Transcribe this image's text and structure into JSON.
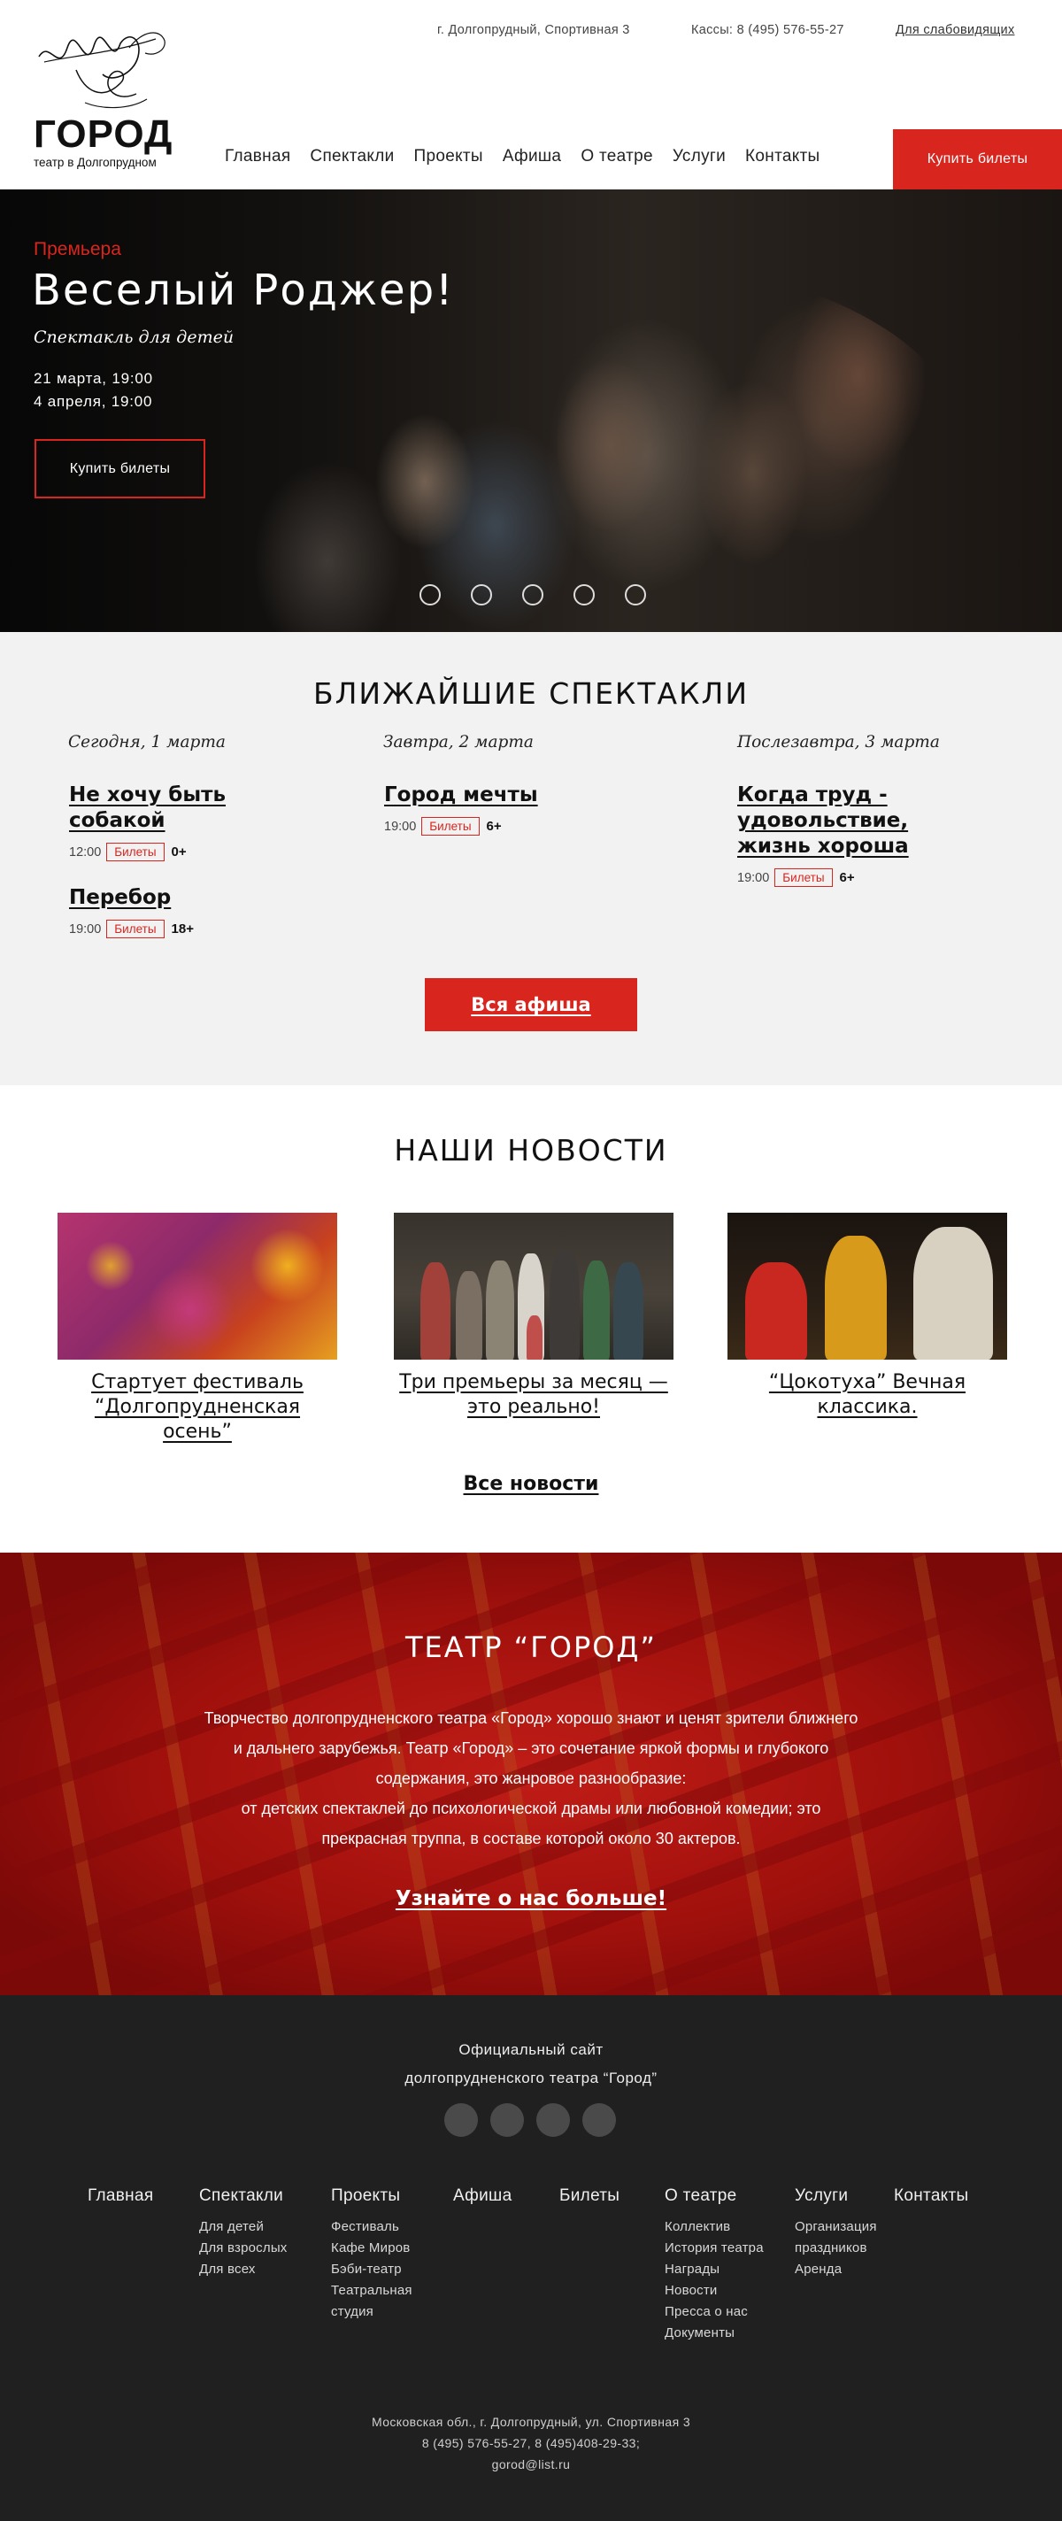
{
  "header": {
    "logo_name": "ГОРОД",
    "logo_sub": "театр в Долгопрудном",
    "address": "г. Долгопрудный, Спортивная 3",
    "phone": "Кассы: 8 (495) 576-55-27",
    "accessibility": "Для слабовидящих",
    "nav": [
      "Главная",
      "Спектакли",
      "Проекты",
      "Афиша",
      "О театре",
      "Услуги",
      "Контакты"
    ],
    "buy_button": "Купить билеты"
  },
  "hero": {
    "kicker": "Премьера",
    "title": "Веселый Роджер!",
    "subtitle": "Спектакль для детей",
    "dates": [
      "21 марта, 19:00",
      "4 апреля, 19:00"
    ],
    "button": "Купить билеты",
    "slide_count": 5
  },
  "upcoming": {
    "title": "БЛИЖАЙШИЕ СПЕКТАКЛИ",
    "days": [
      {
        "label": "Сегодня, 1 марта",
        "shows": [
          {
            "name": "Не хочу быть собакой",
            "time": "12:00",
            "ticket": "Билеты",
            "age": "0+"
          },
          {
            "name": "Перебор",
            "time": "19:00",
            "ticket": "Билеты",
            "age": "18+"
          }
        ]
      },
      {
        "label": "Завтра, 2 марта",
        "shows": [
          {
            "name": "Город мечты",
            "time": "19:00",
            "ticket": "Билеты",
            "age": "6+"
          }
        ]
      },
      {
        "label": "Послезавтра, 3 марта",
        "shows": [
          {
            "name": "Когда труд - удовольствие, жизнь хороша",
            "time": "19:00",
            "ticket": "Билеты",
            "age": "6+"
          }
        ]
      }
    ],
    "all_button": "Вся афиша"
  },
  "news": {
    "title": "НАШИ НОВОСТИ",
    "items": [
      {
        "text": "Стартует фестиваль “Долгопрудненская осень”"
      },
      {
        "text": "Три премьеры за месяц — это реально!"
      },
      {
        "text": "“Цокотуха” Вечная классика."
      }
    ],
    "all_link": "Все новости"
  },
  "about": {
    "title": "ТЕАТР “ГОРОД”",
    "lines": [
      "Творчество долгопрудненского театра «Город» хорошо знают и ценят зрители ближнего",
      "и дальнего зарубежья. Театр «Город» – это сочетание яркой формы и глубокого",
      "содержания, это жанровое разнообразие:",
      "от детских спектаклей до психологической драмы или любовной комедии; это",
      "прекрасная труппа, в составе которой около 30 актеров."
    ],
    "more_link": "Узнайте о нас больше!"
  },
  "footer": {
    "official_1": "Официальный сайт",
    "official_2": "долгопрудненского театра “Город”",
    "social_count": 4,
    "columns": [
      {
        "head": "Главная",
        "items": []
      },
      {
        "head": "Спектакли",
        "items": [
          "Для детей",
          "Для взрослых",
          "Для всех"
        ]
      },
      {
        "head": "Проекты",
        "items": [
          "Фестиваль",
          "Кафе Миров",
          "Бэби-театр",
          "Театральная",
          "студия"
        ]
      },
      {
        "head": "Афиша",
        "items": []
      },
      {
        "head": "Билеты",
        "items": []
      },
      {
        "head": "О театре",
        "items": [
          "Коллектив",
          "История театра",
          "Награды",
          "Новости",
          "Пресса о нас",
          "Документы"
        ]
      },
      {
        "head": "Услуги",
        "items": [
          "Организация",
          "праздников",
          "Аренда"
        ]
      },
      {
        "head": "Контакты",
        "items": []
      }
    ],
    "address": "Московская обл., г. Долгопрудный, ул. Спортивная 3",
    "phones": "8 (495) 576-55-27, 8 (495)408-29-33;",
    "email": "gorod@list.ru"
  },
  "colors": {
    "accent": "#d8261f",
    "footer_bg": "#202020",
    "section_bg": "#f2f2f2"
  }
}
